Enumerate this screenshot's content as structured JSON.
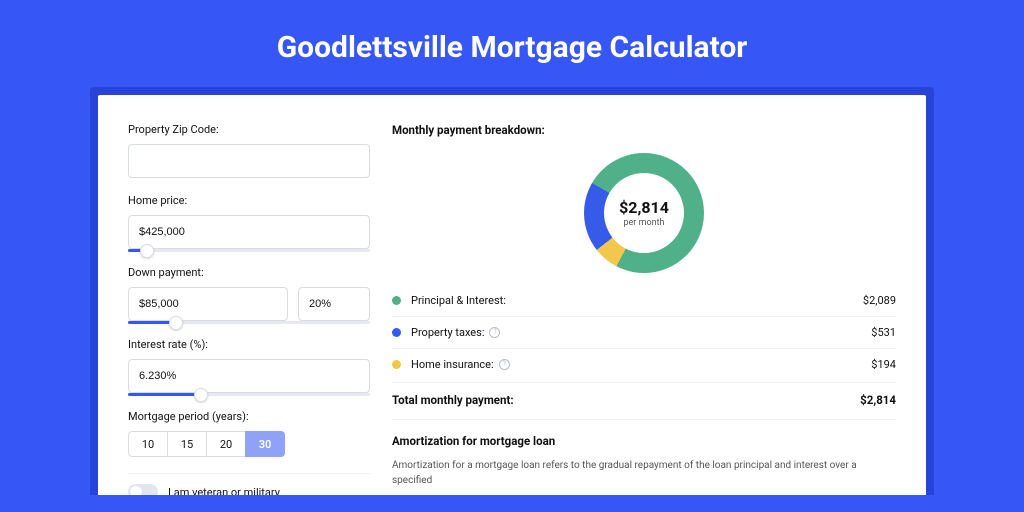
{
  "page": {
    "title": "Goodlettsville Mortgage Calculator"
  },
  "form": {
    "zip": {
      "label": "Property Zip Code:",
      "value": ""
    },
    "home_price": {
      "label": "Home price:",
      "value": "$425,000",
      "slider_pct": 8
    },
    "down_payment": {
      "label": "Down payment:",
      "value": "$85,000",
      "pct_value": "20%",
      "slider_pct": 20
    },
    "interest_rate": {
      "label": "Interest rate (%):",
      "value": "6.230%",
      "slider_pct": 30
    },
    "period": {
      "label": "Mortgage period (years):",
      "options": [
        "10",
        "15",
        "20",
        "30"
      ],
      "active_index": 3
    },
    "veteran": {
      "label": "I am veteran or military",
      "on": false
    }
  },
  "breakdown": {
    "title": "Monthly payment breakdown:",
    "center_amount": "$2,814",
    "center_sub": "per month",
    "items": [
      {
        "label": "Principal & Interest:",
        "value": "$2,089",
        "color": "#4fb08a",
        "num": 2089,
        "info": false
      },
      {
        "label": "Property taxes:",
        "value": "$531",
        "color": "#355be8",
        "num": 531,
        "info": true
      },
      {
        "label": "Home insurance:",
        "value": "$194",
        "color": "#f1c84c",
        "num": 194,
        "info": true
      }
    ],
    "total_label": "Total monthly payment:",
    "total_value": "$2,814"
  },
  "amort": {
    "title": "Amortization for mortgage loan",
    "text": "Amortization for a mortgage loan refers to the gradual repayment of the loan principal and interest over a specified"
  },
  "chart_data": {
    "type": "pie",
    "title": "Monthly payment breakdown",
    "series": [
      {
        "name": "Principal & Interest",
        "value": 2089,
        "color": "#4fb08a"
      },
      {
        "name": "Property taxes",
        "value": 531,
        "color": "#355be8"
      },
      {
        "name": "Home insurance",
        "value": 194,
        "color": "#f1c84c"
      }
    ],
    "center_label": "$2,814 per month",
    "total": 2814
  }
}
